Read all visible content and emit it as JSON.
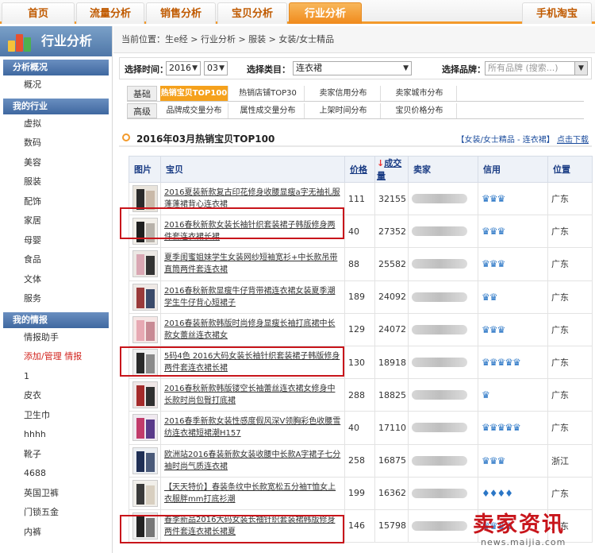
{
  "topnav": {
    "tabs": [
      "首页",
      "流量分析",
      "销售分析",
      "宝贝分析",
      "行业分析"
    ],
    "active": "行业分析",
    "right": "手机淘宝"
  },
  "sidebar": {
    "title": "行业分析",
    "sections": [
      {
        "label": "分析概况",
        "items": [
          "概况"
        ]
      },
      {
        "label": "我的行业",
        "items": [
          "虚拟",
          "数码",
          "美容",
          "服装",
          "配饰",
          "家居",
          "母婴",
          "食品",
          "文体",
          "服务"
        ]
      },
      {
        "label": "我的情报",
        "items": [
          "情报助手",
          "添加/管理 情报",
          "1",
          "皮衣",
          "卫生巾",
          "hhhh",
          "靴子",
          "4688",
          "英国卫裤",
          "门锁五金",
          "内裤"
        ]
      }
    ]
  },
  "breadcrumb": "当前位置：生e经 > 行业分析 > 服装 > 女装/女士精品",
  "filter": {
    "time_label": "选择时间：",
    "year": "2016",
    "month": "03",
    "category_label": "选择类目：",
    "category": "连衣裙",
    "brand_label": "选择品牌：",
    "brand_placeholder": "所有品牌 (搜索...)"
  },
  "subtabs": {
    "row1_label": "基础",
    "row1": [
      "热销宝贝TOP100",
      "热销店铺TOP30",
      "卖家信用分布",
      "卖家城市分布"
    ],
    "row2_label": "高级",
    "row2": [
      "品牌成交量分布",
      "属性成交量分布",
      "上架时间分布",
      "宝贝价格分布"
    ]
  },
  "section": {
    "title": "2016年03月热销宝贝TOP100",
    "crumb": "【女装/女士精品 - 连衣裙】",
    "download": "点击下载"
  },
  "table": {
    "headers": [
      "图片",
      "宝贝",
      "价格",
      "成交量",
      "卖家",
      "信用",
      "位置"
    ],
    "rows": [
      {
        "name": "2016夏装新款复古印花修身收腰显瘦a字无袖礼服蓬蓬裙背心连衣裙",
        "price": "111",
        "volume": "32155",
        "credit": "♛♛♛",
        "location": "广东"
      },
      {
        "name": "2016春秋新款女装长袖针织套装裙子韩版修身两件套连衣裙长裙",
        "price": "40",
        "volume": "27352",
        "credit": "♛♛♛",
        "location": "广东"
      },
      {
        "name": "夏季闺蜜姐妹学生女装网纱短袖宽衫+中长款吊带直筒两件套连衣裙",
        "price": "88",
        "volume": "25582",
        "credit": "♛♛♛",
        "location": "广东"
      },
      {
        "name": "2016春秋新款显瘦牛仔背带裙连衣裙女装夏季潮学生牛仔背心短裙子",
        "price": "189",
        "volume": "24092",
        "credit": "♛♛",
        "location": "广东"
      },
      {
        "name": "2016春装新款韩版时尚修身显瘦长袖打底裙中长款女蕾丝连衣裙女",
        "price": "129",
        "volume": "24072",
        "credit": "♛♛♛",
        "location": "广东"
      },
      {
        "name": "5码4色 2016大码女装长袖针织套装裙子韩版修身两件套连衣裙长裙",
        "price": "130",
        "volume": "18918",
        "credit": "♛♛♛♛♛",
        "location": "广东"
      },
      {
        "name": "2016春秋新款韩版镂空长袖蕾丝连衣裙女修身中长款时尚包臀打底裙",
        "price": "288",
        "volume": "18825",
        "credit": "♛",
        "location": "广东"
      },
      {
        "name": "2016春季新款女装性感度假风深V领胸彩色收腰雪纺连衣裙短裙潮H157",
        "price": "40",
        "volume": "17110",
        "credit": "♛♛♛♛♛",
        "location": "广东"
      },
      {
        "name": "欧洲站2016春装新款女装收腰中长款A字裙子七分袖时尚气质连衣裙",
        "price": "258",
        "volume": "16875",
        "credit": "♛♛♛",
        "location": "浙江"
      },
      {
        "name": "【天天特价】春装条纹中长款宽松五分袖T恤女上衣服胖mm打底衫潮",
        "price": "199",
        "volume": "16362",
        "credit": "♦♦♦♦",
        "location": "广东"
      },
      {
        "name": "春季新品2016大码女装长袖针织套装裙韩版修身两件套连衣裙长裙夏",
        "price": "146",
        "volume": "15798",
        "credit": "♛♛♛♛",
        "location": "广东"
      }
    ]
  },
  "watermark": {
    "cn": "卖家资讯",
    "url": "news.maijia.com"
  },
  "colors": {
    "accent": "#f39a2b",
    "sidebar_blue": "#4f77a8",
    "highlight_red": "#c8151b",
    "link_blue": "#1a4b9c"
  }
}
